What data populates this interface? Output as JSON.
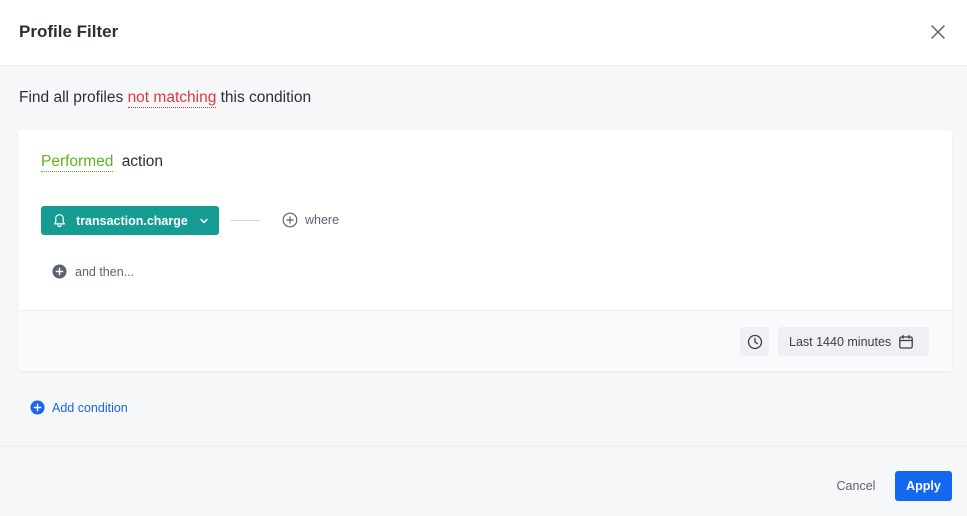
{
  "dialog": {
    "title": "Profile Filter",
    "close_icon": "close-icon"
  },
  "description": {
    "prefix": "Find all profiles",
    "match_mode": "not matching",
    "suffix": "this condition"
  },
  "condition": {
    "qualifier": "Performed",
    "type": "action",
    "event": {
      "icon": "bell-icon",
      "label": "transaction.charge",
      "dropdown_icon": "chevron-down-icon"
    },
    "where": {
      "icon": "plus-circle-icon",
      "label": "where"
    },
    "and_then": {
      "icon": "plus-circle-filled-icon",
      "label": "and then..."
    },
    "time": {
      "clock_icon": "clock-icon",
      "range_label": "Last 1440 minutes",
      "calendar_icon": "calendar-icon"
    }
  },
  "add_condition": {
    "icon": "plus-circle-filled-icon",
    "label": "Add condition"
  },
  "footer": {
    "cancel_label": "Cancel",
    "apply_label": "Apply"
  },
  "colors": {
    "negation": "#e2363b",
    "performed": "#5db31f",
    "event_button": "#159c93",
    "primary": "#1269f0",
    "link": "#1a66e8"
  }
}
